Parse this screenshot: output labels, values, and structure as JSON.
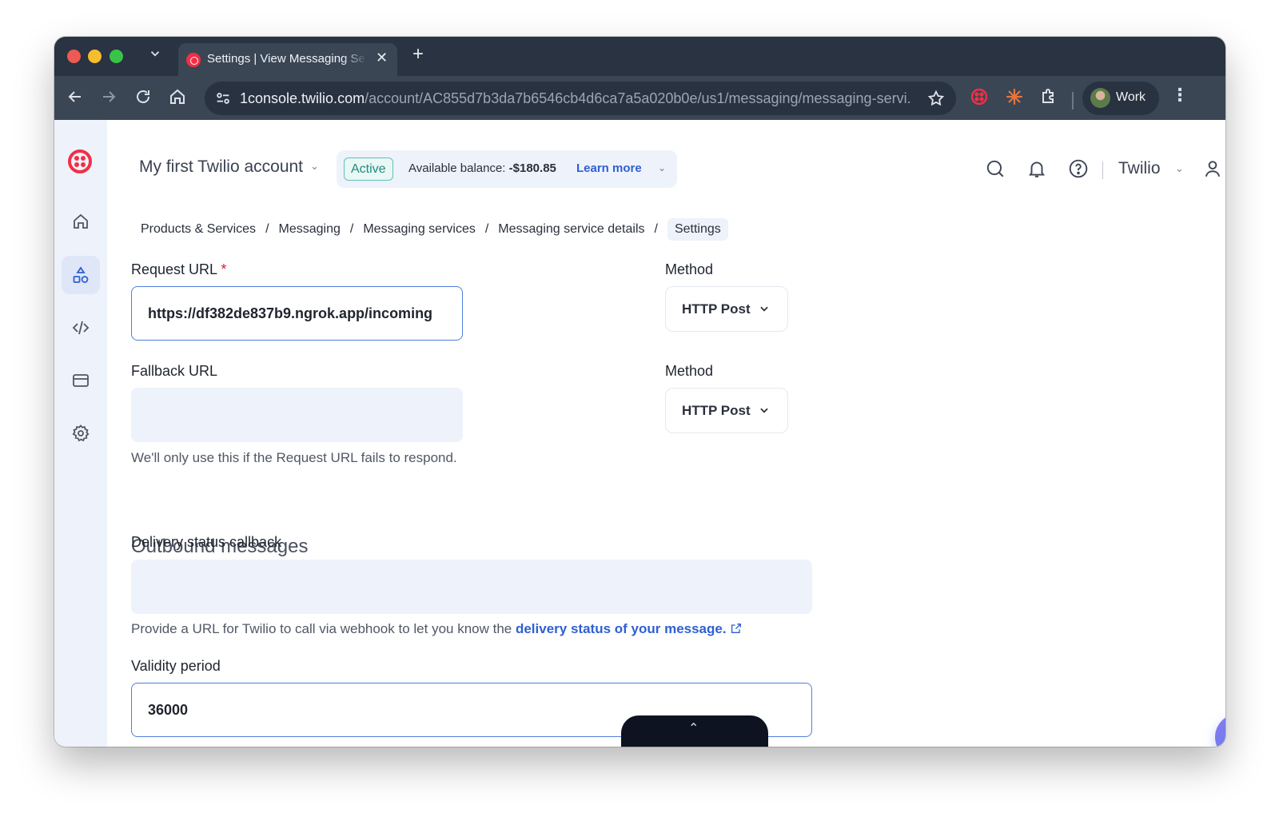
{
  "browser": {
    "tab_title": "Settings | View Messaging Se",
    "url_host": "1console.twilio.com",
    "url_path": "/account/AC855d7b3da7b6546cb4d6ca7a5a020b0e/us1/messaging/messaging-servi...",
    "profile_label": "Work",
    "icons": [
      "tab-list-icon",
      "close-icon",
      "plus-icon",
      "back-icon",
      "forward-icon",
      "reload-icon",
      "home-icon",
      "site-settings-icon",
      "star-icon",
      "twilio-extension-icon",
      "spark-extension-icon",
      "puzzle-icon",
      "more-icon"
    ]
  },
  "header": {
    "account_name": "My first Twilio account",
    "status_badge": "Active",
    "balance_label": "Available balance:",
    "balance_value": "-$180.85",
    "learn_more": "Learn more",
    "org_name": "Twilio"
  },
  "sidebar": {
    "items": [
      {
        "name": "home",
        "icon": "home-icon"
      },
      {
        "name": "products",
        "icon": "shapes-icon",
        "active": true
      },
      {
        "name": "develop",
        "icon": "code-icon"
      },
      {
        "name": "billing",
        "icon": "credit-card-icon"
      },
      {
        "name": "settings",
        "icon": "gear-icon"
      }
    ]
  },
  "breadcrumb": [
    "Products & Services",
    "Messaging",
    "Messaging services",
    "Messaging service details",
    "Settings"
  ],
  "form": {
    "request_url": {
      "label": "Request URL",
      "required_mark": "*",
      "value": "https://df382de837b9.ngrok.app/incoming"
    },
    "request_method": {
      "label": "Method",
      "value": "HTTP Post"
    },
    "fallback_url": {
      "label": "Fallback URL",
      "value": "",
      "help": "We'll only use this if the Request URL fails to respond."
    },
    "fallback_method": {
      "label": "Method",
      "value": "HTTP Post"
    },
    "outbound_title": "Outbound messages",
    "delivery_callback": {
      "label": "Delivery status callback",
      "value": "",
      "help_prefix": "Provide a URL for Twilio to call via webhook to let you know the ",
      "help_link": "delivery status of your message."
    },
    "validity_period": {
      "label": "Validity period",
      "value": "36000"
    }
  },
  "colors": {
    "brand": "#f22f46",
    "accent": "#2f5fd2",
    "sidebar_bg": "#eef2fb",
    "chrome_dark": "#293341"
  }
}
